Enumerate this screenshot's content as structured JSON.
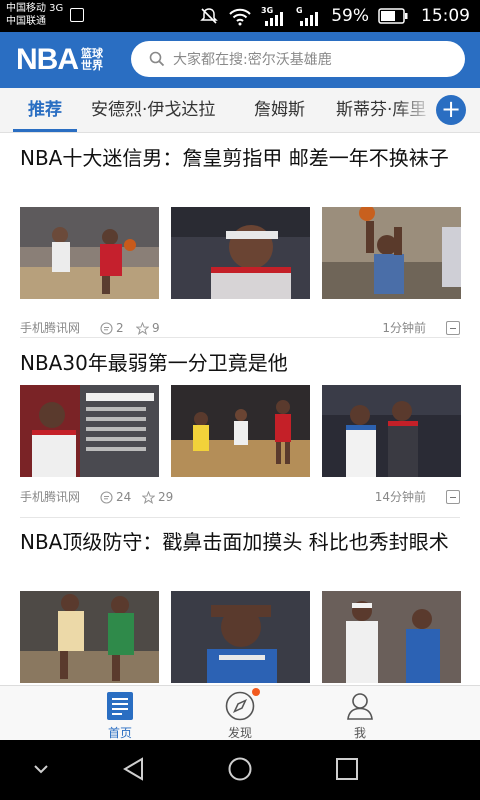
{
  "status_bar": {
    "carrier_1": "中国移动 3G",
    "carrier_2": "中国联通",
    "network_1": "3G",
    "network_2": "G",
    "battery": "59%",
    "time": "15:09"
  },
  "header": {
    "logo_main": "NBA",
    "logo_sub_1": "篮球",
    "logo_sub_2": "世界",
    "search_placeholder": "大家都在搜:密尔沃基雄鹿"
  },
  "tabs": [
    "推荐",
    "安德烈·伊戈达拉",
    "詹姆斯",
    "斯蒂芬·库里"
  ],
  "tab_add_label": "+",
  "articles": [
    {
      "title": "NBA十大迷信男：詹皇剪指甲 邮差一年不换袜子",
      "source": "手机腾讯网",
      "comments": "2",
      "likes": "9",
      "time": "1分钟前",
      "images": [
        "basketball-players-photo",
        "basketball-player-photo",
        "basketball-dunk-photo"
      ]
    },
    {
      "title": "NBA30年最弱第一分卫竟是他",
      "source": "手机腾讯网",
      "comments": "24",
      "likes": "29",
      "time": "14分钟前",
      "images": [
        "basketball-player-graphic",
        "basketball-game-photo",
        "basketball-players-photo"
      ]
    },
    {
      "title": "NBA顶级防守：戳鼻击面加摸头 科比也秀封眼术",
      "images": [
        "basketball-defense-photo",
        "basketball-player-photo",
        "basketball-players-photo"
      ]
    }
  ],
  "bottom_nav": [
    {
      "label": "首页",
      "icon": "home-icon",
      "active": true
    },
    {
      "label": "发现",
      "icon": "compass-icon",
      "active": false
    },
    {
      "label": "我",
      "icon": "profile-icon",
      "active": false
    }
  ],
  "colors": {
    "brand": "#2a6ec2",
    "notification_dot": "#f25a1f"
  }
}
